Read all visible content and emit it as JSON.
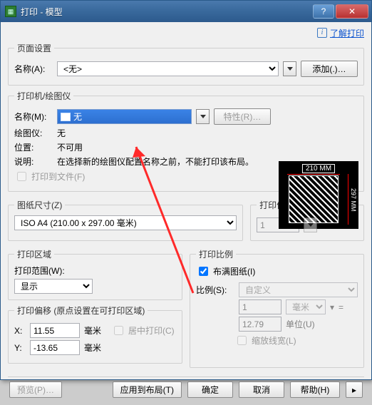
{
  "window": {
    "title": "打印 - 模型"
  },
  "help_link": "了解打印",
  "page_setup": {
    "legend": "页面设置",
    "name_label": "名称(A):",
    "name_value": "<无>",
    "add_button": "添加(.)…"
  },
  "printer": {
    "legend": "打印机/绘图仪",
    "name_label": "名称(M):",
    "name_value": "无",
    "properties_button": "特性(R)…",
    "plotter_label": "绘图仪:",
    "plotter_value": "无",
    "location_label": "位置:",
    "location_value": "不可用",
    "desc_label": "说明:",
    "desc_value": "在选择新的绘图仪配置名称之前，不能打印该布局。",
    "to_file": "打印到文件(F)",
    "preview_top": "210 MM",
    "preview_side": "297 MM"
  },
  "paper": {
    "legend": "图纸尺寸(Z)",
    "value": "ISO A4 (210.00 x 297.00 毫米)",
    "copies_legend": "打印份数(B)",
    "copies_value": "1"
  },
  "area": {
    "legend": "打印区域",
    "range_label": "打印范围(W):",
    "range_value": "显示"
  },
  "scale": {
    "legend": "打印比例",
    "fit": "布满图纸(I)",
    "ratio_label": "比例(S):",
    "ratio_value": "自定义",
    "unit_num": "1",
    "unit_select": "毫米",
    "drawing_units": "12.79",
    "unit_label": "单位(U)",
    "scale_lineweights": "缩放线宽(L)"
  },
  "offset": {
    "legend": "打印偏移 (原点设置在可打印区域)",
    "x_label": "X:",
    "x_value": "11.55",
    "y_label": "Y:",
    "y_value": "-13.65",
    "unit": "毫米",
    "center": "居中打印(C)"
  },
  "footer": {
    "preview": "预览(P)…",
    "apply_layout": "应用到布局(T)",
    "ok": "确定",
    "cancel": "取消",
    "help": "帮助(H)"
  }
}
